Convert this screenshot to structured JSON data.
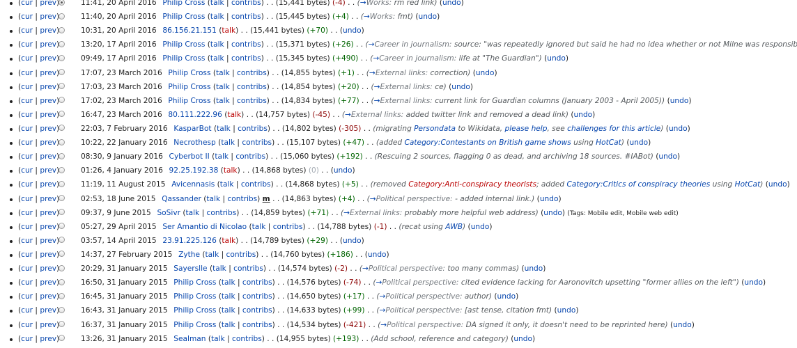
{
  "colors": {
    "link": "#0645ad",
    "redlink": "#ba0000",
    "positive": "#006400",
    "negative": "#8b0000",
    "neutral": "#a2a9b1"
  },
  "labels": {
    "cur": "cur",
    "prev": "prev",
    "talk": "talk",
    "contribs": "contribs",
    "undo": "undo",
    "bytes_suffix": " bytes)",
    "minor": "m"
  },
  "revisions": [
    {
      "date": "11:41, 20 April 2016",
      "user": "Philip Cross",
      "bytes": "(15,441",
      "diff": "(-4)",
      "sign": "minus",
      "section": "Works:",
      "summary": " rm red link)",
      "checked": true
    },
    {
      "date": "11:40, 20 April 2016",
      "user": "Philip Cross",
      "bytes": "(15,445",
      "diff": "(+4)",
      "sign": "plus",
      "section": "Works:",
      "summary": " fmt)"
    },
    {
      "date": "10:31, 20 April 2016",
      "user": "86.156.21.151",
      "ip": true,
      "bytes": "(15,441",
      "diff": "(+70)",
      "sign": "plus"
    },
    {
      "date": "13:20, 17 April 2016",
      "user": "Philip Cross",
      "bytes": "(15,371",
      "diff": "(+26)",
      "sign": "plus",
      "section": "Career in journalism:",
      "summary": " source: \"was repeatedly ignored but said he had no idea whether or not Milne was responsible\")"
    },
    {
      "date": "09:49, 17 April 2016",
      "user": "Philip Cross",
      "bytes": "(15,345",
      "diff": "(+490)",
      "sign": "plus",
      "section": "Career in journalism:",
      "summary": " life at \"The Guardian\")"
    },
    {
      "date": "17:07, 23 March 2016",
      "user": "Philip Cross",
      "bytes": "(14,855",
      "diff": "(+1)",
      "sign": "plus",
      "section": "External links:",
      "summary": " correction)"
    },
    {
      "date": "17:03, 23 March 2016",
      "user": "Philip Cross",
      "bytes": "(14,854",
      "diff": "(+20)",
      "sign": "plus",
      "section": "External links:",
      "summary": " ce)"
    },
    {
      "date": "17:02, 23 March 2016",
      "user": "Philip Cross",
      "bytes": "(14,834",
      "diff": "(+77)",
      "sign": "plus",
      "section": "External links:",
      "summary": " current link for Guardian columns (January 2003 - April 2005))"
    },
    {
      "date": "16:47, 23 March 2016",
      "user": "80.111.222.96",
      "ip": true,
      "bytes": "(14,757",
      "diff": "(-45)",
      "sign": "minus",
      "section": "External links:",
      "summary": " added twitter link and removed a dead link)"
    },
    {
      "date": "22:03, 7 February 2016",
      "user": "KasparBot",
      "bytes": "(14,802",
      "diff": "(-305)",
      "sign": "minus",
      "plain": "(migrating ",
      "l1": "Persondata",
      "p2": " to Wikidata, ",
      "l2": "please help",
      "p3": ", see ",
      "l3": "challenges for this article",
      "p4": ")"
    },
    {
      "date": "10:22, 22 January 2016",
      "user": "Necrothesp",
      "bytes": "(15,107",
      "diff": "(+47)",
      "sign": "plus",
      "plain": "(added ",
      "l1": "Category:Contestants on British game shows",
      "p2": " using ",
      "l2": "HotCat",
      "p3": ")"
    },
    {
      "date": "08:30, 9 January 2016",
      "user": "Cyberbot II",
      "bytes": "(15,060",
      "diff": "(+192)",
      "sign": "plus",
      "plain": "(Rescuing 2 sources, flagging 0 as dead, and archiving 18 sources. #IABot)"
    },
    {
      "date": "01:26, 4 January 2016",
      "user": "92.25.192.38",
      "ip": true,
      "bytes": "(14,868",
      "diff": "(0)",
      "sign": "zero"
    },
    {
      "date": "11:19, 11 August 2015",
      "user": "Avicennasis",
      "bytes": "(14,868",
      "diff": "(+5)",
      "sign": "plus",
      "plain": "(removed ",
      "l1red": "Category:Anti-conspiracy theorists",
      "p2": "; added ",
      "l2": "Category:Critics of conspiracy theories",
      "p3": " using ",
      "l3": "HotCat",
      "p4": ")"
    },
    {
      "date": "02:53, 18 June 2015",
      "user": "Qassander",
      "bytes": "(14,863",
      "diff": "(+4)",
      "sign": "plus",
      "minor": true,
      "section": "Political perspective:",
      "summary": " - added internal link.)"
    },
    {
      "date": "09:37, 9 June 2015",
      "user": "SoSivr",
      "bytes": "(14,859",
      "diff": "(+71)",
      "sign": "plus",
      "section": "External links:",
      "summary": " probably more helpful web address)",
      "tags": "(Tags: Mobile edit, Mobile web edit)"
    },
    {
      "date": "05:27, 29 April 2015",
      "user": "Ser Amantio di Nicolao",
      "bytes": "(14,788",
      "diff": "(-1)",
      "sign": "minus",
      "plain": "(recat using ",
      "l1": "AWB",
      "p2": ")"
    },
    {
      "date": "03:57, 14 April 2015",
      "user": "23.91.225.126",
      "ip": true,
      "bytes": "(14,789",
      "diff": "(+29)",
      "sign": "plus"
    },
    {
      "date": "14:37, 27 February 2015",
      "user": "Zythe",
      "bytes": "(14,760",
      "diff": "(+186)",
      "sign": "plus"
    },
    {
      "date": "20:29, 31 January 2015",
      "user": "Sayerslle",
      "bytes": "(14,574",
      "diff": "(-2)",
      "sign": "minus",
      "section": "Political perspective:",
      "summary": " too many commas)"
    },
    {
      "date": "16:50, 31 January 2015",
      "user": "Philip Cross",
      "bytes": "(14,576",
      "diff": "(-74)",
      "sign": "minus",
      "section": "Political perspective:",
      "summary": " cited evidence lacking for Aaronovitch upsetting \"former allies on the left\")"
    },
    {
      "date": "16:45, 31 January 2015",
      "user": "Philip Cross",
      "bytes": "(14,650",
      "diff": "(+17)",
      "sign": "plus",
      "section": "Political perspective:",
      "summary": " author)"
    },
    {
      "date": "16:43, 31 January 2015",
      "user": "Philip Cross",
      "bytes": "(14,633",
      "diff": "(+99)",
      "sign": "plus",
      "section": "Political perspective:",
      "summary": " [ast tense, citation fmt)"
    },
    {
      "date": "16:37, 31 January 2015",
      "user": "Philip Cross",
      "bytes": "(14,534",
      "diff": "(-421)",
      "sign": "minus",
      "section": "Political perspective:",
      "summary": " DA signed it only, it doesn't need to be reprinted here)"
    },
    {
      "date": "13:26, 31 January 2015",
      "user": "Sealman",
      "bytes": "(14,955",
      "diff": "(+193)",
      "sign": "plus",
      "plain": "(Add school, reference and category)"
    }
  ]
}
